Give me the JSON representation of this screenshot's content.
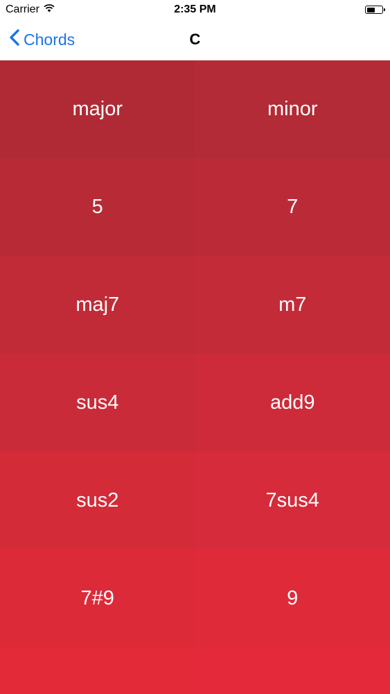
{
  "status_bar": {
    "carrier": "Carrier",
    "time": "2:35 PM",
    "battery_level": 0.6
  },
  "nav": {
    "back_label": "Chords",
    "title": "C"
  },
  "chords": [
    [
      "major",
      "minor"
    ],
    [
      "5",
      "7"
    ],
    [
      "maj7",
      "m7"
    ],
    [
      "sus4",
      "add9"
    ],
    [
      "sus2",
      "7sus4"
    ],
    [
      "7#9",
      "9"
    ],
    [
      "",
      ""
    ]
  ],
  "colors": {
    "accent": "#1a73e8",
    "tile_top": "#b02a35",
    "tile_bottom": "#e42a3a"
  }
}
